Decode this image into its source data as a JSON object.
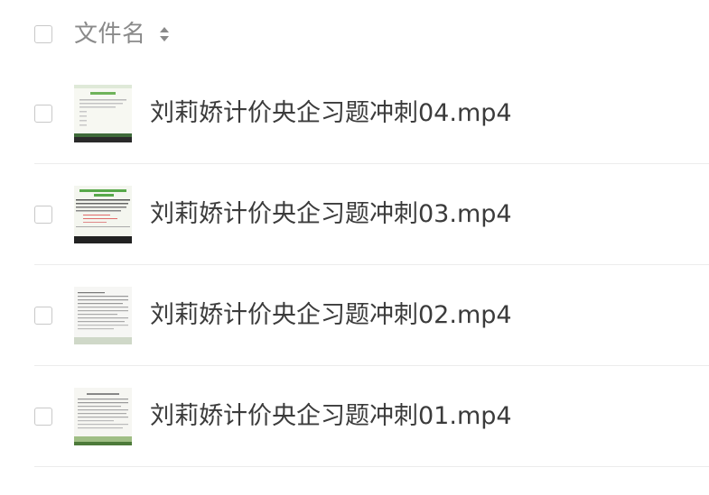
{
  "header": {
    "name_label": "文件名"
  },
  "files": [
    {
      "name": "刘莉娇计价央企习题冲刺04.mp4"
    },
    {
      "name": "刘莉娇计价央企习题冲刺03.mp4"
    },
    {
      "name": "刘莉娇计价央企习题冲刺02.mp4"
    },
    {
      "name": "刘莉娇计价央企习题冲刺01.mp4"
    }
  ],
  "icons": {
    "sort": "sort-icon",
    "video_thumbnail": "video-thumbnail"
  },
  "colors": {
    "header_text": "#8a8a8a",
    "file_text": "#3b3b3b",
    "checkbox_border": "#c8c8c8",
    "divider": "#ececec",
    "thumb_green": "#58a84a"
  }
}
